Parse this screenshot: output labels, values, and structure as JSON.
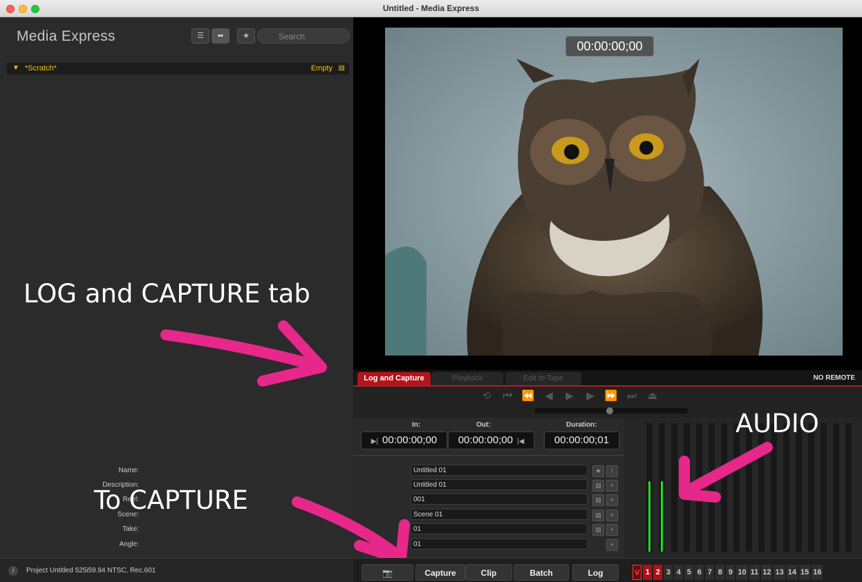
{
  "window": {
    "title": "Untitled - Media Express"
  },
  "sidebar": {
    "brand": "Media Express",
    "search_placeholder": "Search",
    "bin": {
      "name": "*Scratch*",
      "status": "Empty"
    }
  },
  "annotations": {
    "log_capture": "LOG and CAPTURE tab",
    "to_capture": "To CAPTURE",
    "audio": "AUDIO"
  },
  "viewer": {
    "timecode": "00:00:00;00"
  },
  "tabs": [
    {
      "label": "Log and Capture",
      "active": true
    },
    {
      "label": "Playback",
      "active": false
    },
    {
      "label": "Edit to Tape",
      "active": false
    }
  ],
  "remote_status": "NO REMOTE",
  "log": {
    "in_label": "In:",
    "out_label": "Out:",
    "duration_label": "Duration:",
    "in": "00:00:00;00",
    "out": "00:00:00;00",
    "duration": "00:00:00;01",
    "fields": [
      {
        "label": "Name:",
        "value": "Untitled 01"
      },
      {
        "label": "Description:",
        "value": "Untitled 01"
      },
      {
        "label": "Reel:",
        "value": "001"
      },
      {
        "label": "Scene:",
        "value": "Scene 01"
      },
      {
        "label": "Take:",
        "value": "01"
      },
      {
        "label": "Angle:",
        "value": "01"
      }
    ]
  },
  "audio_levels": [
    {
      "channel": 1,
      "level": 0.55
    },
    {
      "channel": 2,
      "level": 0.55
    }
  ],
  "status": {
    "project": "Project Untitled  525i59.94 NTSC, Rec.601"
  },
  "bottom": {
    "capture": "Capture",
    "clip": "Clip",
    "batch": "Batch",
    "log": "Log",
    "channels": [
      "V",
      "1",
      "2",
      "3",
      "4",
      "5",
      "6",
      "7",
      "8",
      "9",
      "10",
      "11",
      "12",
      "13",
      "14",
      "15",
      "16"
    ]
  },
  "colors": {
    "accent_red": "#b2141b",
    "bin_yellow": "#f5c400",
    "meter_green": "#18e018",
    "annotation_pink": "#e8278b"
  }
}
